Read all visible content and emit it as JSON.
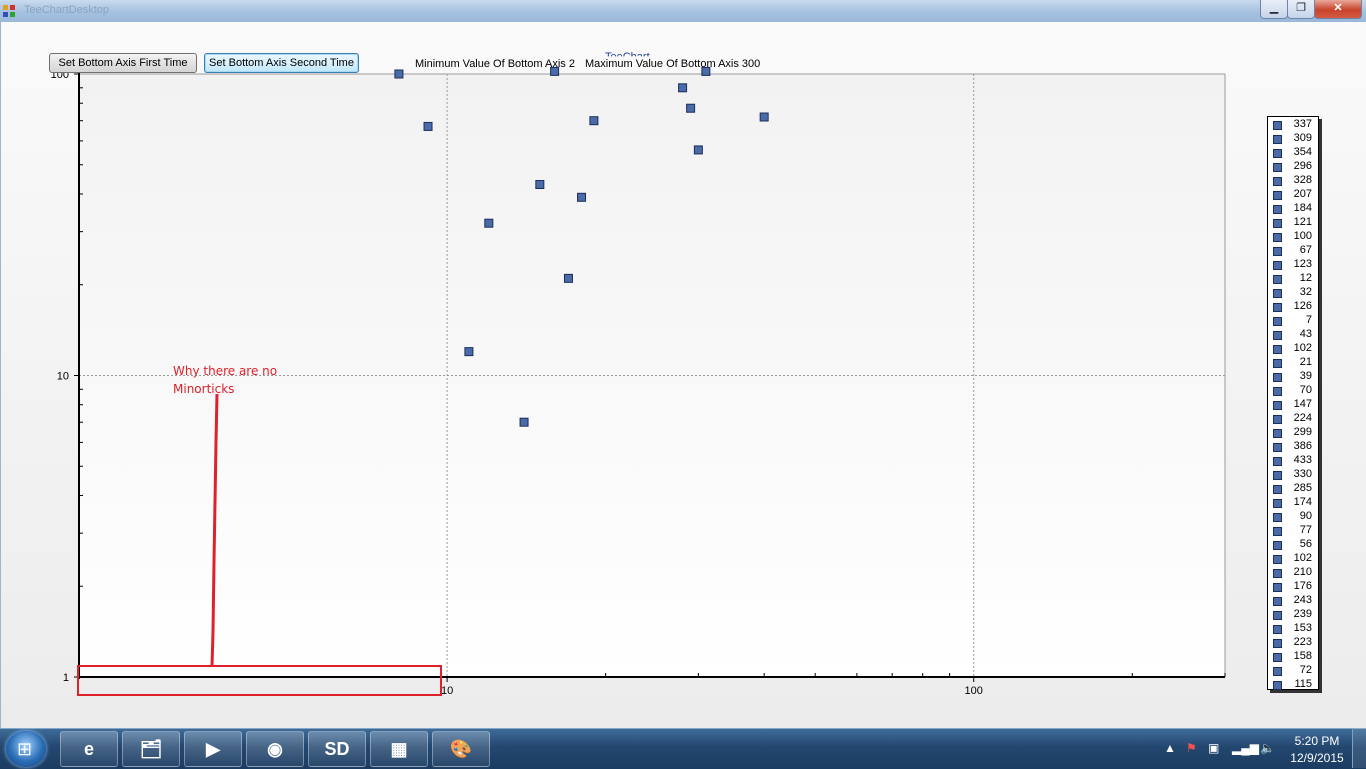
{
  "window": {
    "title": "TeeChartDesktop",
    "close_glyph": "✕",
    "min_glyph": "▁",
    "max_glyph": "❐"
  },
  "controls": {
    "btn_first": "Set Bottom Axis First Time",
    "btn_second": "Set Bottom Axis Second Time",
    "min_label": "Minimum Value Of Bottom Axis  2",
    "max_label": "Maximum Value Of Bottom Axis  300"
  },
  "chart_data": {
    "type": "scatter",
    "title": "TeeChart",
    "x_scale": "log",
    "y_scale": "log",
    "xlim": [
      2,
      300
    ],
    "ylim": [
      1,
      100
    ],
    "x_tick_labels": [
      "10",
      "100"
    ],
    "y_tick_labels": [
      "100",
      "10",
      "1"
    ],
    "grid": true,
    "legend_position": "right",
    "marker": "square",
    "color": "#4a6aa8",
    "points": [
      {
        "x": 8.1,
        "y": 100
      },
      {
        "x": 9.2,
        "y": 67
      },
      {
        "x": 16.0,
        "y": 102
      },
      {
        "x": 28.0,
        "y": 90
      },
      {
        "x": 31.0,
        "y": 102
      },
      {
        "x": 29.0,
        "y": 77
      },
      {
        "x": 19.0,
        "y": 70
      },
      {
        "x": 40.0,
        "y": 72
      },
      {
        "x": 30.0,
        "y": 56
      },
      {
        "x": 15.0,
        "y": 43
      },
      {
        "x": 18.0,
        "y": 39
      },
      {
        "x": 12.0,
        "y": 32
      },
      {
        "x": 17.0,
        "y": 21
      },
      {
        "x": 11.0,
        "y": 12
      },
      {
        "x": 14.0,
        "y": 7
      }
    ],
    "legend_values": [
      "337",
      "309",
      "354",
      "296",
      "328",
      "207",
      "184",
      "121",
      "100",
      "67",
      "123",
      "12",
      "32",
      "126",
      "7",
      "43",
      "102",
      "21",
      "39",
      "70",
      "147",
      "224",
      "299",
      "386",
      "433",
      "330",
      "285",
      "174",
      "90",
      "77",
      "56",
      "102",
      "210",
      "176",
      "243",
      "239",
      "153",
      "223",
      "158",
      "72",
      "115"
    ]
  },
  "annotation": {
    "text_line1": "Why there are no",
    "text_line2": "Minorticks",
    "color": "#e0202a"
  },
  "taskbar": {
    "apps": [
      {
        "name": "internet-explorer",
        "glyph": "e"
      },
      {
        "name": "file-explorer",
        "glyph": "🗂"
      },
      {
        "name": "media-player",
        "glyph": "▶"
      },
      {
        "name": "chrome",
        "glyph": "◉"
      },
      {
        "name": "sd-tool",
        "glyph": "SD"
      },
      {
        "name": "office",
        "glyph": "▦"
      },
      {
        "name": "paint",
        "glyph": "🎨"
      }
    ],
    "clock_time": "5:20 PM",
    "clock_date": "12/9/2015"
  }
}
